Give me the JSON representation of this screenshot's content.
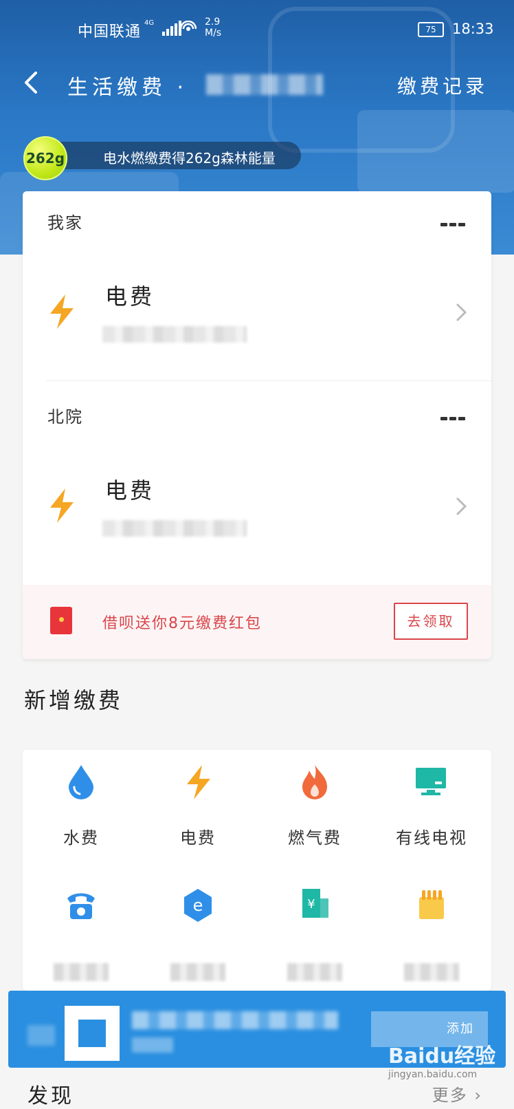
{
  "status_bar": {
    "carrier": "中国联通",
    "network": "4G",
    "speed_value": "2.9",
    "speed_unit": "M/s",
    "battery": "75",
    "time": "18:33"
  },
  "nav": {
    "title": "生活缴费 ·",
    "record": "缴费记录"
  },
  "energy": {
    "amount": "262g",
    "text": "电水燃缴费得262g森林能量"
  },
  "groups": [
    {
      "title": "我家",
      "bill_name": "电费"
    },
    {
      "title": "北院",
      "bill_name": "电费"
    }
  ],
  "promo": {
    "text": "借呗送你8元缴费红包",
    "button": "去领取"
  },
  "new_payment": {
    "title": "新增缴费",
    "items": [
      {
        "label": "水费",
        "icon": "water-drop-icon"
      },
      {
        "label": "电费",
        "icon": "bolt-icon"
      },
      {
        "label": "燃气费",
        "icon": "flame-icon"
      },
      {
        "label": "有线电视",
        "icon": "tv-icon"
      }
    ],
    "icons_row2": [
      "telephone-icon",
      "broadband-icon",
      "property-fee-icon",
      "heating-icon"
    ]
  },
  "banner": {
    "add_label": "添加"
  },
  "discover": {
    "title": "发现",
    "more": "更多"
  },
  "watermark": {
    "brand": "Baidu经验",
    "url": "jingyan.baidu.com"
  },
  "colors": {
    "primary": "#2a78c6",
    "accent_red": "#d9454a",
    "bolt": "#f5a623",
    "water": "#2f8fe8",
    "flame": "#f06a3c",
    "tv": "#1fb7a6"
  }
}
